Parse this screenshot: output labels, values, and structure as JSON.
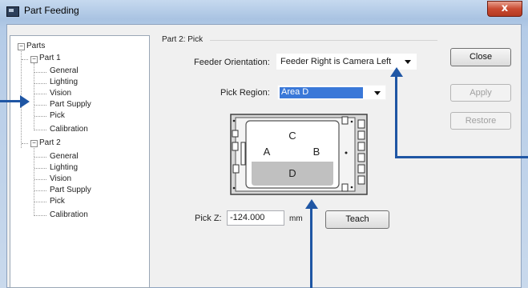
{
  "window": {
    "title": "Part Feeding",
    "close_glyph": "x"
  },
  "tree": {
    "root": "Parts",
    "part1": {
      "label": "Part 1",
      "children": [
        "General",
        "Lighting",
        "Vision",
        "Part Supply",
        "Pick",
        "Calibration"
      ]
    },
    "part2": {
      "label": "Part 2",
      "children": [
        "General",
        "Lighting",
        "Vision",
        "Part Supply",
        "Pick",
        "Calibration"
      ]
    },
    "expand_glyph": "−"
  },
  "group": {
    "title": "Part 2: Pick"
  },
  "feeder_orientation": {
    "label": "Feeder Orientation:",
    "value": "Feeder Right is Camera Left"
  },
  "pick_region": {
    "label": "Pick Region:",
    "value": "Area D"
  },
  "feeder_diagram": {
    "areas": [
      "C",
      "A",
      "B",
      "D"
    ]
  },
  "pick_z": {
    "label": "Pick Z:",
    "value": "-124.000",
    "unit": "mm"
  },
  "buttons": {
    "close": "Close",
    "apply": "Apply",
    "restore": "Restore",
    "teach": "Teach"
  },
  "colors": {
    "selection": "#3a78d8",
    "callout_arrow": "#1f56a4",
    "close_button": "#c94b32",
    "highlighted_area": "#c0c0c0"
  }
}
